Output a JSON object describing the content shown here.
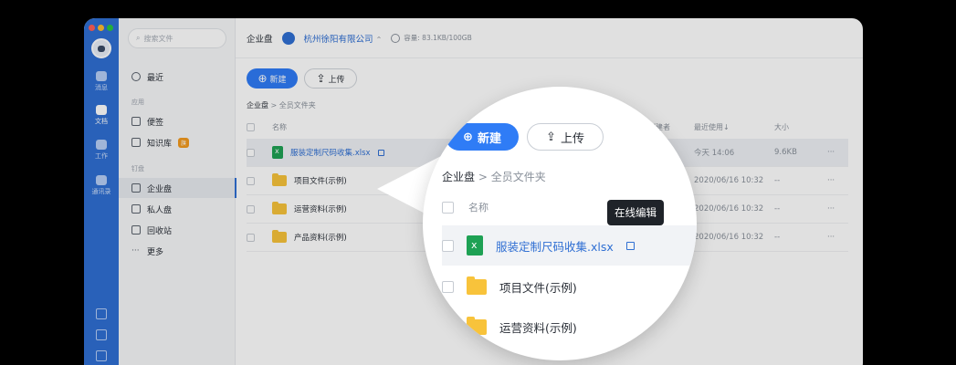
{
  "search": {
    "placeholder": "搜索文件"
  },
  "rail": {
    "items": [
      {
        "label": "消息",
        "icon": "chat-icon"
      },
      {
        "label": "文档",
        "icon": "document-icon"
      },
      {
        "label": "工作",
        "icon": "grid-icon"
      },
      {
        "label": "通讯录",
        "icon": "contacts-icon"
      }
    ]
  },
  "sidebar": {
    "recent": "最近",
    "section_apps": "应用",
    "notes": "便签",
    "kb": "知识库",
    "kb_badge": "旗",
    "section_disk": "钉盘",
    "enterprise": "企业盘",
    "private": "私人盘",
    "trash": "回收站",
    "more": "更多"
  },
  "topbar": {
    "title": "企业盘",
    "company": "杭州徐阳有限公司",
    "company_caret": "⌃",
    "storage": "容量: 83.1KB/100GB"
  },
  "toolbar": {
    "new_label": "新建",
    "upload_label": "上传"
  },
  "breadcrumb": {
    "root": "企业盘",
    "sep": ">",
    "current": "全员文件夹"
  },
  "table": {
    "headers": {
      "name": "名称",
      "owner": "创建者",
      "recent": "最近使用↓",
      "size": "大小"
    },
    "rows": [
      {
        "name": "服装定制尺码收集.xlsx",
        "type": "xlsx",
        "date": "今天 14:06",
        "size": "9.6KB",
        "more": "···"
      },
      {
        "name": "项目文件(示例)",
        "type": "folder",
        "date": "2020/06/16 10:32",
        "size": "--",
        "more": "···"
      },
      {
        "name": "运营资料(示例)",
        "type": "folder",
        "date": "2020/06/16 10:32",
        "size": "--",
        "more": "···"
      },
      {
        "name": "产品资料(示例)",
        "type": "folder",
        "date": "2020/06/16 10:32",
        "size": "--",
        "more": "···"
      }
    ]
  },
  "tooltip": {
    "online_edit": "在线编辑"
  },
  "colors": {
    "accent": "#2f7cf6",
    "rail": "#2f6fd3",
    "excel": "#1ea154",
    "folder": "#f8c33b"
  }
}
